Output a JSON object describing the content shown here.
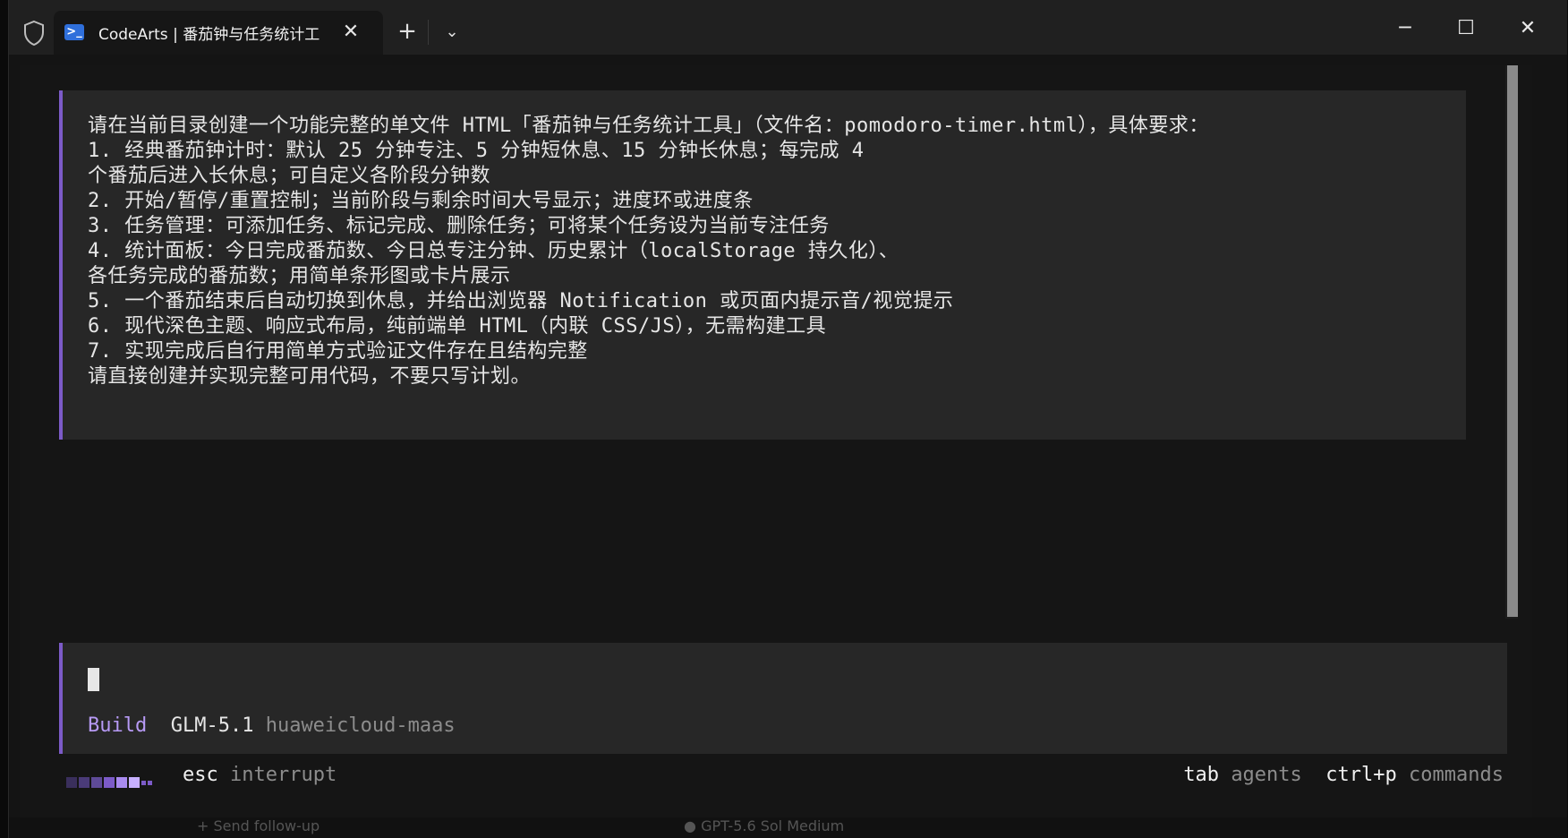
{
  "window": {
    "tab_title": "CodeArts | 番茄钟与任务统计工",
    "tab_icon_glyph": ">_",
    "close_tab_glyph": "✕",
    "new_tab_glyph": "+",
    "dropdown_glyph": "⌄",
    "minimize_glyph": "─",
    "maximize_glyph": "☐",
    "close_glyph": "✕"
  },
  "prompt": {
    "lines": [
      "请在当前目录创建一个功能完整的单文件 HTML「番茄钟与任务统计工具」（文件名：pomodoro-timer.html），具体要求：",
      "1. 经典番茄钟计时：默认 25 分钟专注、5 分钟短休息、15 分钟长休息；每完成 4",
      "个番茄后进入长休息；可自定义各阶段分钟数",
      "2. 开始/暂停/重置控制；当前阶段与剩余时间大号显示；进度环或进度条",
      "3. 任务管理：可添加任务、标记完成、删除任务；可将某个任务设为当前专注任务",
      "4. 统计面板：今日完成番茄数、今日总专注分钟、历史累计（localStorage 持久化）、",
      "各任务完成的番茄数；用简单条形图或卡片展示",
      "5. 一个番茄结束后自动切换到休息，并给出浏览器 Notification 或页面内提示音/视觉提示",
      "6. 现代深色主题、响应式布局，纯前端单 HTML（内联 CSS/JS），无需构建工具",
      "7. 实现完成后自行用简单方式验证文件存在且结构完整",
      "请直接创建并实现完整可用代码，不要只写计划。"
    ]
  },
  "input": {
    "mode": "Build",
    "model": "GLM-5.1",
    "provider": "huaweicloud-maas"
  },
  "status": {
    "interrupt_key": "esc",
    "interrupt_label": "interrupt",
    "agents_key": "tab",
    "agents_label": "agents",
    "commands_key": "ctrl+p",
    "commands_label": "commands"
  },
  "background": {
    "hint": "Send follow-up",
    "model_hint": "GPT-5.6 Sol Medium"
  },
  "colors": {
    "accent": "#7c5bc8",
    "build": "#b79af5",
    "panel": "#272727"
  }
}
